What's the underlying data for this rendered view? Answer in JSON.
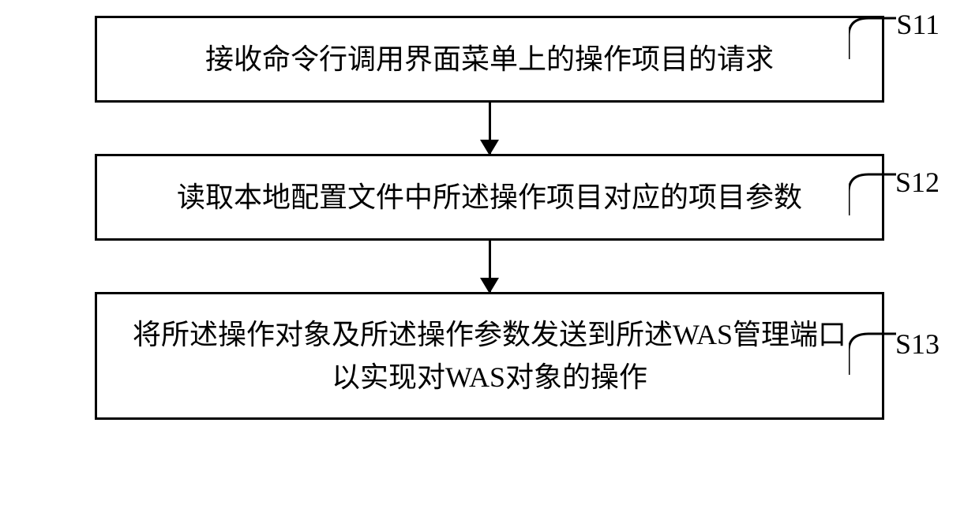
{
  "flowchart": {
    "steps": [
      {
        "id": "s11",
        "label": "S11",
        "text": "接收命令行调用界面菜单上的操作项目的请求"
      },
      {
        "id": "s12",
        "label": "S12",
        "text": "读取本地配置文件中所述操作项目对应的项目参数"
      },
      {
        "id": "s13",
        "label": "S13",
        "text": "将所述操作对象及所述操作参数发送到所述WAS管理端口以实现对WAS对象的操作"
      }
    ]
  }
}
